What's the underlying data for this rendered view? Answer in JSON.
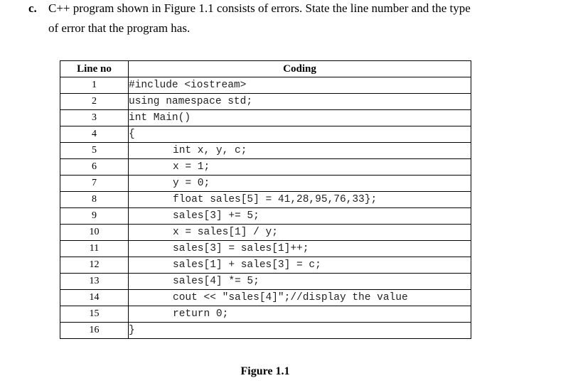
{
  "question": {
    "label": "c.",
    "line1": "C++ program shown in Figure 1.1  consists of  errors. State the line number and the type",
    "line2": "of error that the program has."
  },
  "table": {
    "headers": {
      "line_no": "Line no",
      "coding": "Coding"
    },
    "rows": [
      {
        "line": "1",
        "code": "#include <iostream>",
        "indent": false
      },
      {
        "line": "2",
        "code": "using namespace std;",
        "indent": false
      },
      {
        "line": "3",
        "code": "int Main()",
        "indent": false
      },
      {
        "line": "4",
        "code": "{",
        "indent": false
      },
      {
        "line": "5",
        "code": "int x, y, c;",
        "indent": true
      },
      {
        "line": "6",
        "code": "x = 1;",
        "indent": true
      },
      {
        "line": "7",
        "code": "y = 0;",
        "indent": true
      },
      {
        "line": "8",
        "code": "float sales[5] = 41,28,95,76,33};",
        "indent": true
      },
      {
        "line": "9",
        "code": "sales[3] += 5;",
        "indent": true
      },
      {
        "line": "10",
        "code": "x = sales[1] / y;",
        "indent": true
      },
      {
        "line": "11",
        "code": "sales[3] = sales[1]++;",
        "indent": true
      },
      {
        "line": "12",
        "code": "sales[1] + sales[3] = c;",
        "indent": true
      },
      {
        "line": "13",
        "code": "sales[4] *= 5;",
        "indent": true
      },
      {
        "line": "14",
        "code": "cout << \"sales[4]\";//display the value",
        "indent": true
      },
      {
        "line": "15",
        "code": "return 0;",
        "indent": true
      },
      {
        "line": "16",
        "code": "}",
        "indent": false
      }
    ]
  },
  "figure_caption": "Figure 1.1"
}
